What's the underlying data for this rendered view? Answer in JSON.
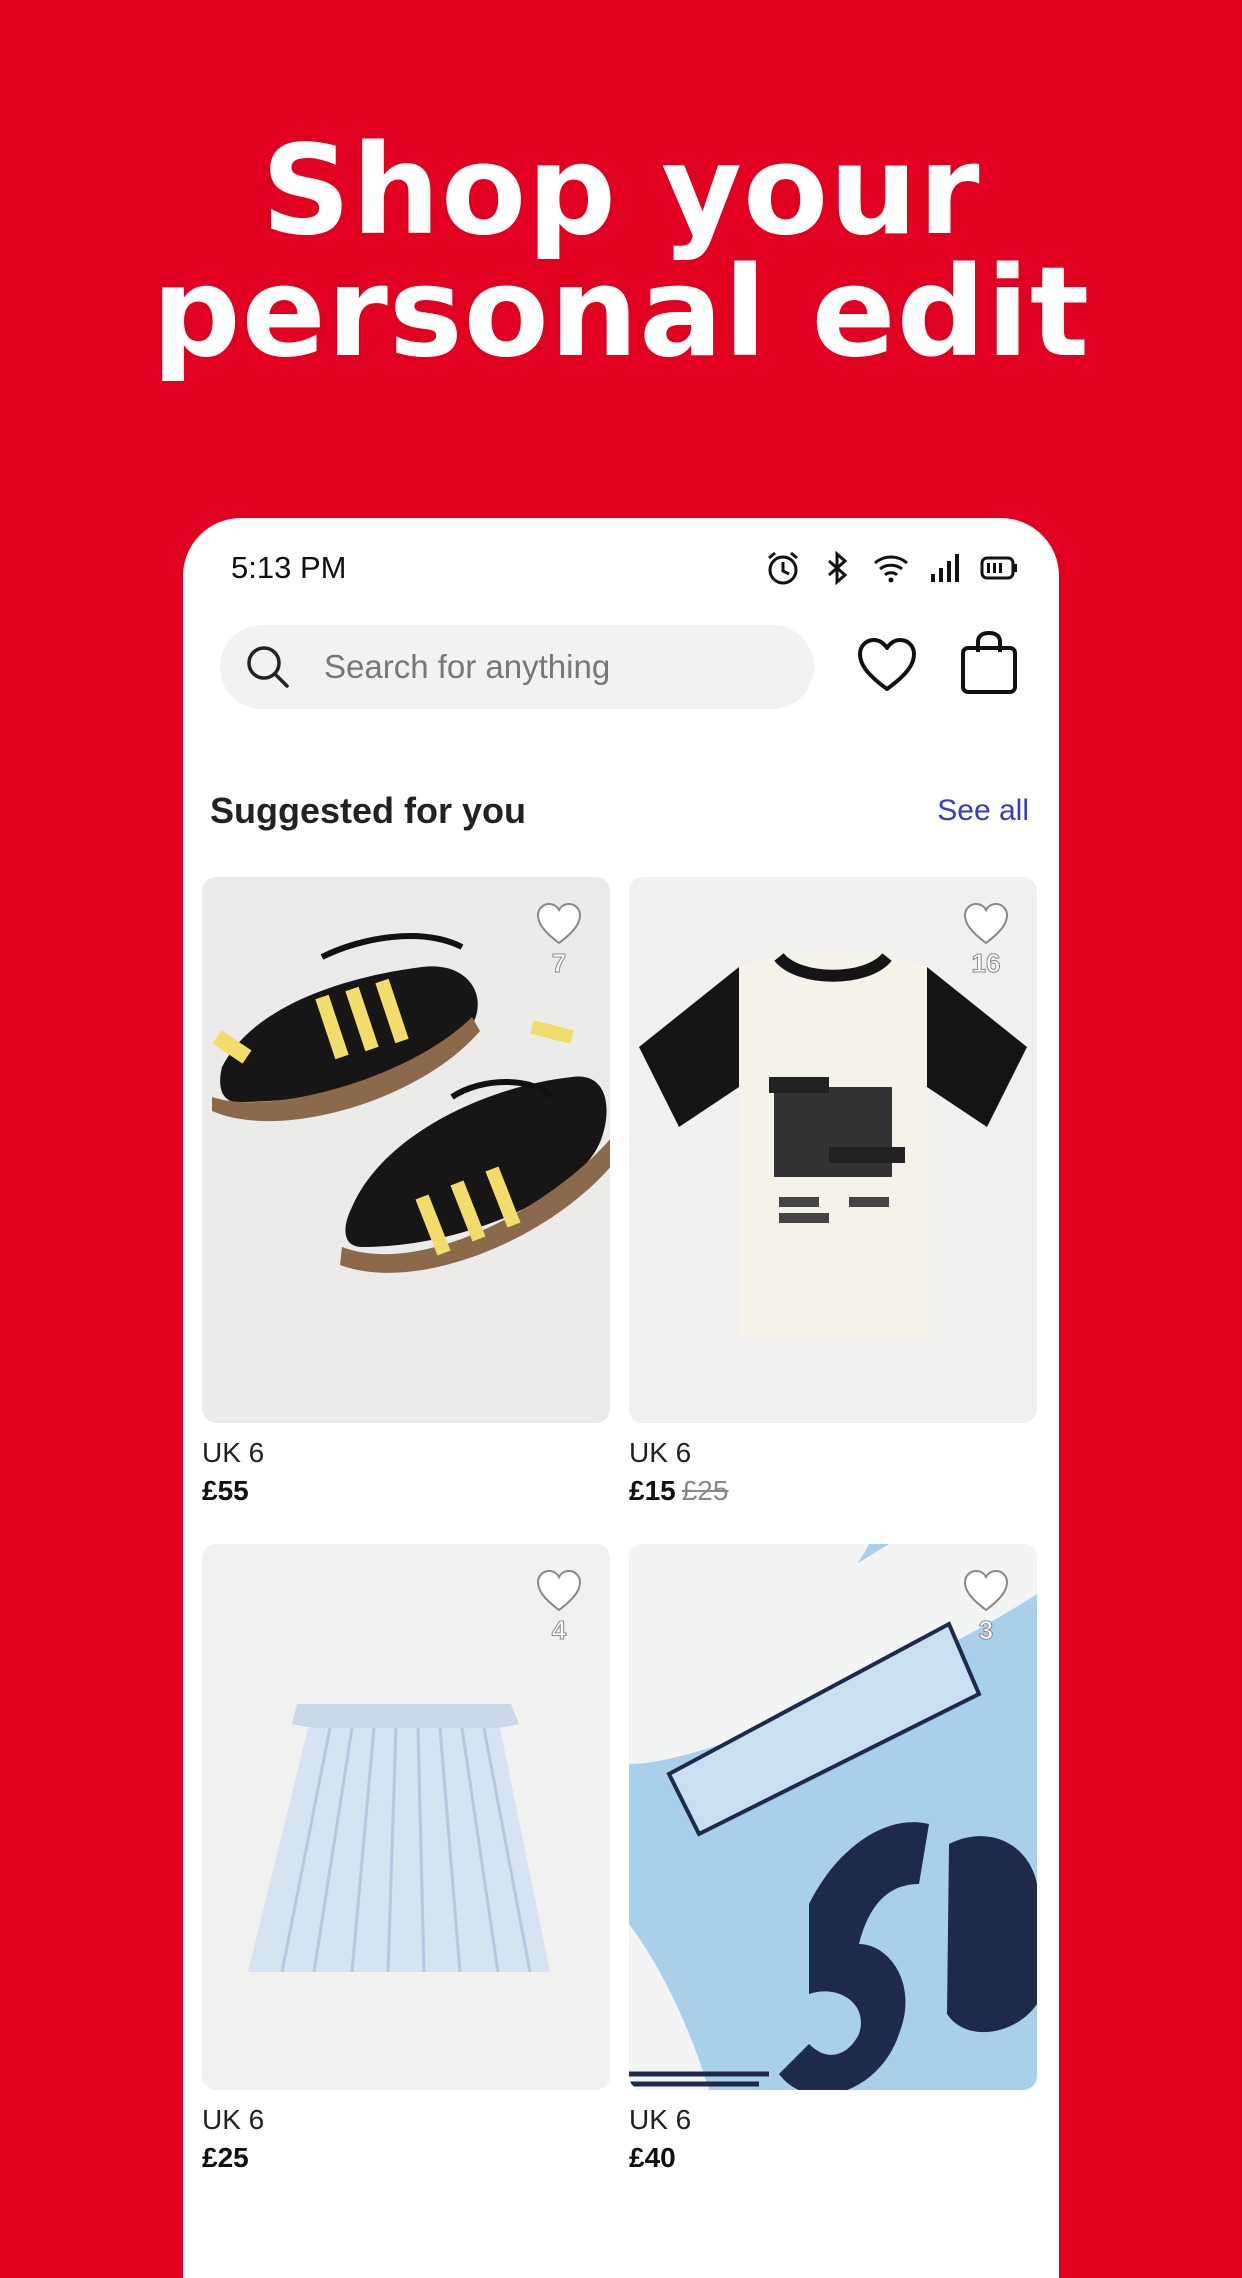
{
  "headline": {
    "line1": "Shop your",
    "line2": "personal edit"
  },
  "status_bar": {
    "time": "5:13 PM"
  },
  "search": {
    "placeholder": "Search for anything"
  },
  "section": {
    "title": "Suggested for you",
    "see_all": "See all"
  },
  "products": [
    {
      "size": "UK 6",
      "price": "£55",
      "old_price": "",
      "likes": "7",
      "image": "black-yellow-sneakers"
    },
    {
      "size": "UK 6",
      "price": "£15",
      "old_price": "£25",
      "likes": "16",
      "image": "band-raglan-tshirt"
    },
    {
      "size": "UK 6",
      "price": "£25",
      "old_price": "",
      "likes": "4",
      "image": "pleated-skirt"
    },
    {
      "size": "UK 6",
      "price": "£40",
      "old_price": "",
      "likes": "3",
      "image": "superstar-jersey"
    }
  ],
  "colors": {
    "brand_red": "#e20020",
    "link_blue": "#3a3aca"
  }
}
